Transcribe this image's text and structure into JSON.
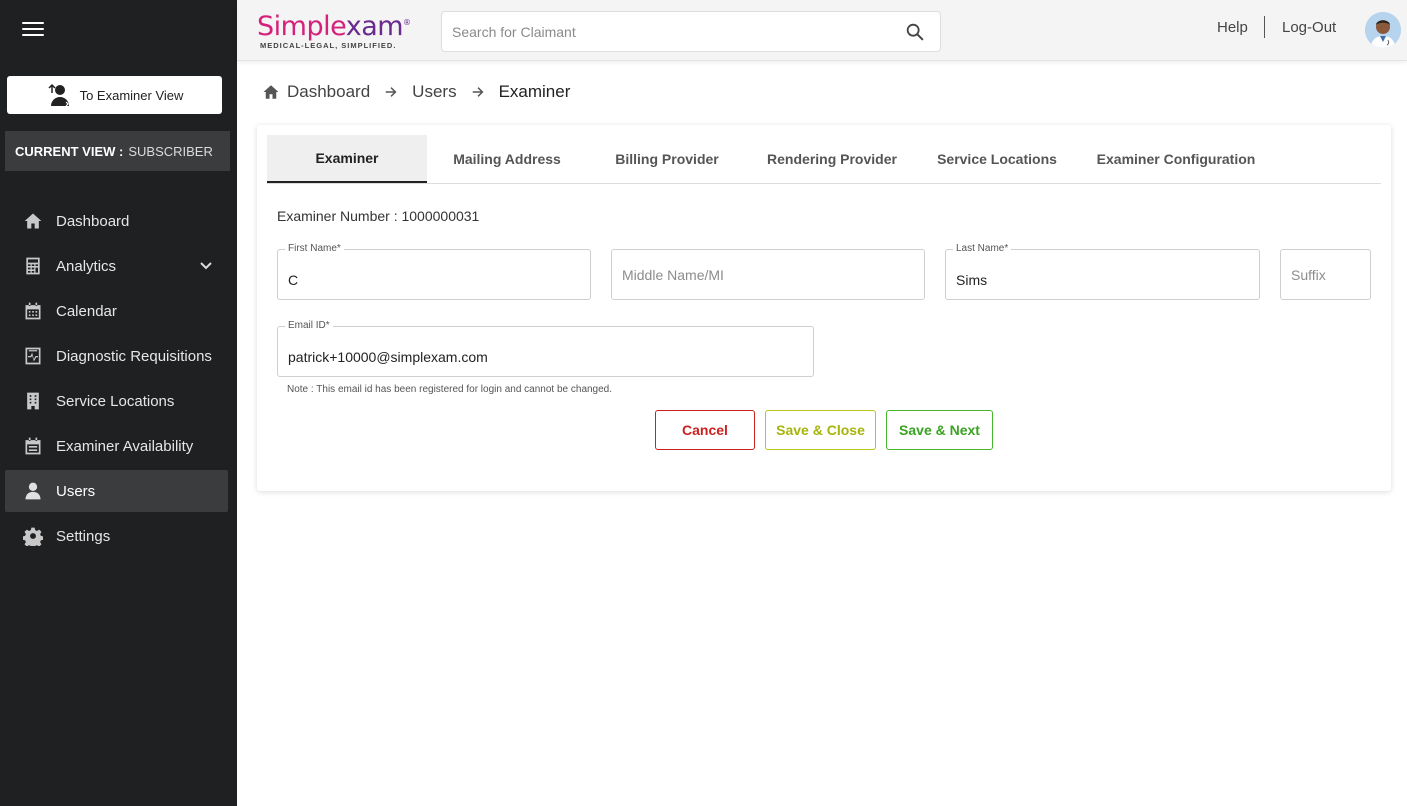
{
  "sidebar": {
    "examiner_view_label": "To Examiner View",
    "current_view_label": "CURRENT VIEW :",
    "current_view_value": "SUBSCRIBER",
    "items": [
      {
        "label": "Dashboard",
        "icon": "home-icon"
      },
      {
        "label": "Analytics",
        "icon": "calculator-icon"
      },
      {
        "label": "Calendar",
        "icon": "calendar-icon"
      },
      {
        "label": "Diagnostic Requisitions",
        "icon": "requisition-icon"
      },
      {
        "label": "Service Locations",
        "icon": "building-icon"
      },
      {
        "label": "Examiner Availability",
        "icon": "calendar-check-icon"
      },
      {
        "label": "Users",
        "icon": "user-icon"
      },
      {
        "label": "Settings",
        "icon": "gear-icon"
      }
    ],
    "active_item": "Users"
  },
  "header": {
    "logo_text_1": "Simple",
    "logo_text_2": "xam",
    "logo_reg": "®",
    "logo_tagline": "MEDICAL-LEGAL, SIMPLIFIED.",
    "search_placeholder": "Search for Claimant",
    "help_label": "Help",
    "logout_label": "Log-Out"
  },
  "breadcrumb": {
    "items": [
      "Dashboard",
      "Users",
      "Examiner"
    ]
  },
  "tabs": [
    {
      "label": "Examiner",
      "active": true
    },
    {
      "label": "Mailing Address",
      "active": false
    },
    {
      "label": "Billing Provider",
      "active": false
    },
    {
      "label": "Rendering Provider",
      "active": false
    },
    {
      "label": "Service Locations",
      "active": false
    },
    {
      "label": "Examiner Configuration",
      "active": false
    }
  ],
  "form": {
    "examiner_number": "Examiner Number : 1000000031",
    "first_name_label": "First Name*",
    "first_name_value": "C",
    "middle_name_placeholder": "Middle Name/MI",
    "last_name_label": "Last Name*",
    "last_name_value": "Sims",
    "suffix_placeholder": "Suffix",
    "email_label": "Email ID*",
    "email_value": "patrick+10000@simplexam.com",
    "email_note": "Note : This email id has been registered for login and cannot be changed."
  },
  "actions": {
    "cancel_label": "Cancel",
    "save_close_label": "Save & Close",
    "save_next_label": "Save & Next"
  },
  "colors": {
    "sidebar_bg": "#1f2022",
    "brand_pink": "#d4217b",
    "brand_purple": "#6a2a8e",
    "cancel_red": "#cc1f1f",
    "save_close_olive": "#a6b40c",
    "save_next_green": "#3aa321"
  }
}
